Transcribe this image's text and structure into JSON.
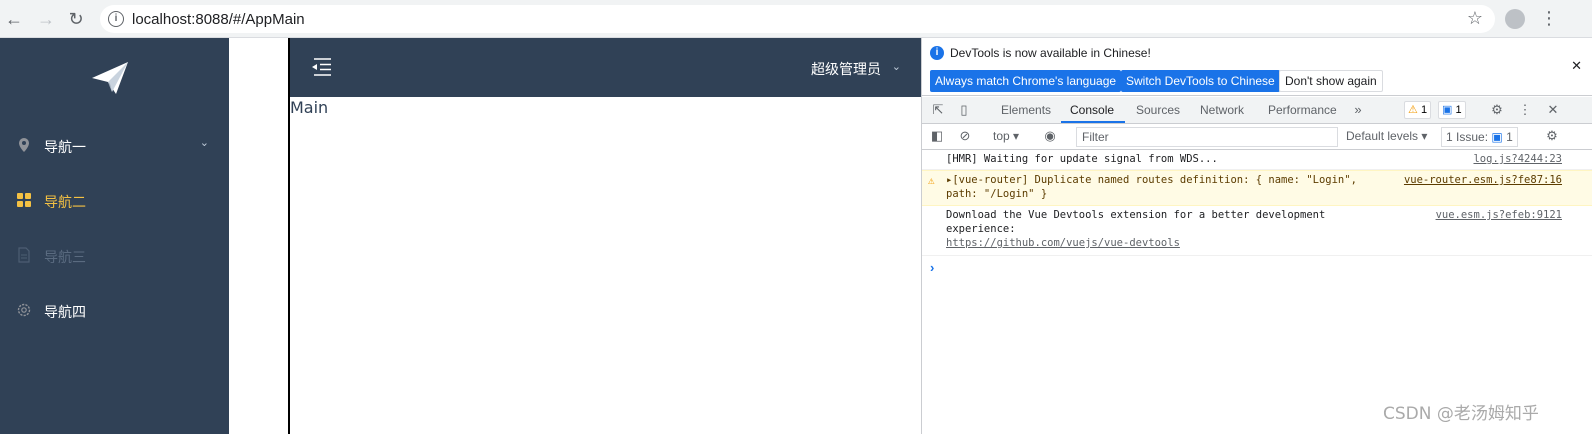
{
  "browser": {
    "url": "localhost:8088/#/AppMain"
  },
  "sidebar": {
    "items": [
      {
        "label": "导航一",
        "icon": "location-icon",
        "state": "normal"
      },
      {
        "label": "导航二",
        "icon": "grid-icon",
        "state": "active"
      },
      {
        "label": "导航三",
        "icon": "document-icon",
        "state": "disabled"
      },
      {
        "label": "导航四",
        "icon": "gear-icon",
        "state": "normal"
      }
    ]
  },
  "header": {
    "user": "超级管理员"
  },
  "main": {
    "text": "Main"
  },
  "devtools": {
    "infobar": {
      "message": "DevTools is now available in Chinese!",
      "btn_match": "Always match Chrome's language",
      "btn_switch": "Switch DevTools to Chinese",
      "btn_dismiss": "Don't show again"
    },
    "tabs": [
      "Elements",
      "Console",
      "Sources",
      "Network",
      "Performance"
    ],
    "active_tab": "Console",
    "warn_count": "1",
    "info_count": "1",
    "filter_bar": {
      "context": "top",
      "filter_placeholder": "Filter",
      "levels": "Default levels",
      "issues": "1 Issue:",
      "issues_count": "1"
    },
    "messages": [
      {
        "level": "info",
        "text": "[HMR] Waiting for update signal from WDS...",
        "source": "log.js?4244:23"
      },
      {
        "level": "warn",
        "text": "▸[vue-router] Duplicate named routes definition: { name: \"Login\",\npath: \"/Login\" }",
        "source": "vue-router.esm.js?fe87:16"
      },
      {
        "level": "info",
        "text": "Download the Vue Devtools extension for a better development\nexperience:",
        "link": "https://github.com/vuejs/vue-devtools",
        "source": "vue.esm.js?efeb:9121"
      }
    ]
  },
  "watermark": "CSDN @老汤姆知乎",
  "colors": {
    "sidebar_bg": "#304156",
    "active_menu": "#f4c143",
    "devtools_accent": "#1a73e8"
  }
}
